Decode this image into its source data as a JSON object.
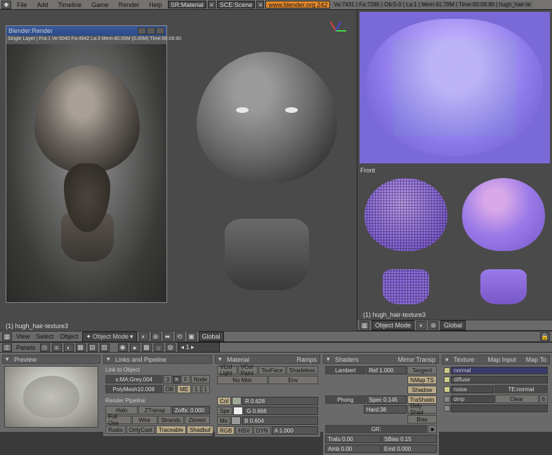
{
  "topmenu": {
    "file": "File",
    "add": "Add",
    "timeline": "Timeline",
    "game": "Game",
    "render": "Render",
    "help": "Help"
  },
  "screen_sel": "SR:Material",
  "scene_sel": "SCE:Scene",
  "blender_link": "www.blender.org 242",
  "stats": "Ve:7431 | Fa:7285 | Ob:5-0 | La:1 | Mem:41.79M | Time:00:09.90 | hugh_hair-te",
  "render_win": {
    "title": "Blender:Render",
    "info": "Single Layer | Fra:1 Ve:5040 Fa:4942 La:3 Mem:40.05M (0.00M) Time:00:09.90"
  },
  "viewport_obj": "(1) hugh_hair-texture3",
  "front_label": "Front",
  "hdr": {
    "view": "View",
    "select": "Select",
    "object": "Object",
    "mode": "Object Mode",
    "orient": "Global"
  },
  "panels_menu": "Panels",
  "panel": {
    "preview": "Preview",
    "links": "Links and Pipeline",
    "link_to_obj": "Link to Object",
    "mat_name": "x:MA:Grey.004",
    "mesh_name": "PolyMesh10.008",
    "me_btn": "ME",
    "ob_btn": "OB",
    "node": "Node",
    "render_pipe": "Render Pipeline",
    "halo": "Halo",
    "ztransp": "ZTransp",
    "zoffs": "Zoffs: 0.000",
    "fullosa": "Full Osa",
    "wire": "Wire",
    "strands": "Strands",
    "zinvert": "Zinvert",
    "radio": "Radio",
    "onlycast": "OnlyCast",
    "traceable": "Traceable",
    "shadbuf": "Shadbuf",
    "material": "Material",
    "ramps": "Ramps",
    "vcollight": "VCol Light",
    "vcolpaint": "VCol Paint",
    "texface": "TexFace",
    "shadeless": "Shadeless",
    "nomist": "No Mist",
    "env": "Env",
    "col": "Col",
    "spe": "Spe",
    "mir": "Mir",
    "rgb": "RGB",
    "hsv": "HSV",
    "dyn": "DYN",
    "r": "R 0.628",
    "g": "G 0.666",
    "b": "B 0.604",
    "shaders": "Shaders",
    "mirror": "Mirror Transp",
    "lambert": "Lambert",
    "ref": "Ref 1.000",
    "phong": "Phong",
    "spec": "Spec 0.145",
    "hard": "Hard:38",
    "tangent": "Tangent",
    "nmapts": "NMap TS",
    "shadow": "Shadow",
    "trashado": "TraShado",
    "onlyshad": "Only Shad",
    "bias": "Bias",
    "gr": "GR:",
    "tralu": "Tralu 0.00",
    "sbias": "SBias 0.15",
    "amb": "Amb 0.00",
    "emit": "Emit 0.000",
    "texture": "Texture",
    "mapinput": "Map Input",
    "mapto": "Map To",
    "normal": "normal",
    "diffuse": "diffuse",
    "noise": "noise",
    "te_normal": "TE:normal",
    "dmp": "dmp",
    "clear": "Clear",
    "six": "6"
  }
}
